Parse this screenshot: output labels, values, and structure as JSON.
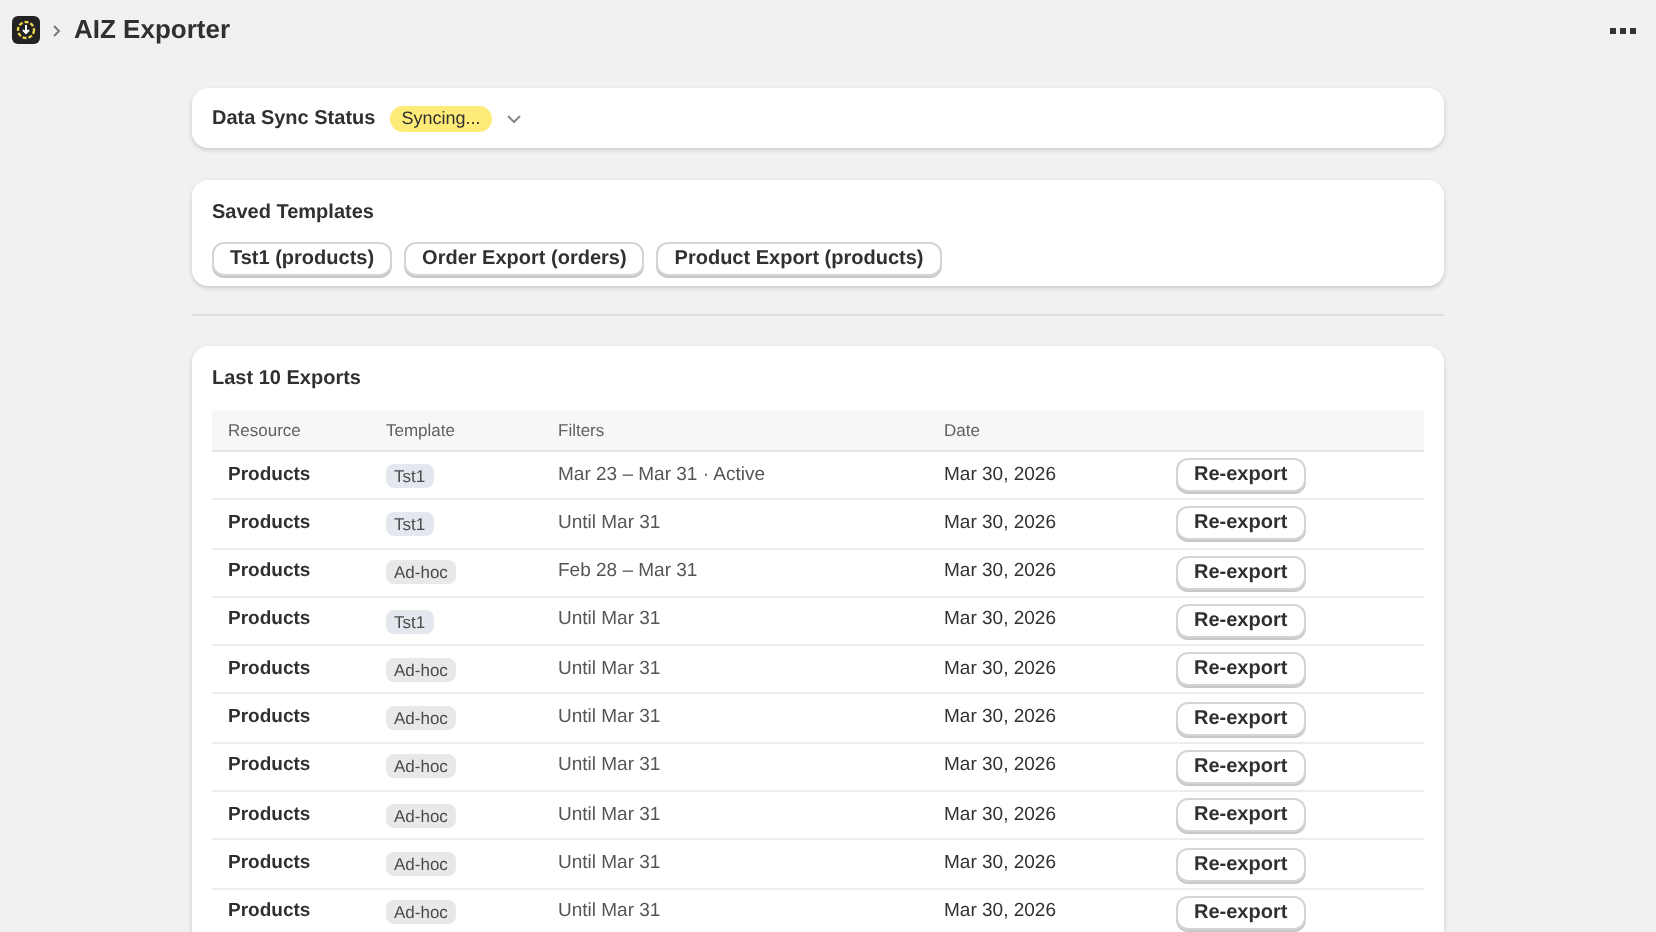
{
  "header": {
    "title": "AIZ Exporter"
  },
  "sync": {
    "title": "Data Sync Status",
    "status": "Syncing..."
  },
  "templates": {
    "title": "Saved Templates",
    "items": [
      "Tst1 (products)",
      "Order Export (orders)",
      "Product Export (products)"
    ]
  },
  "exports": {
    "title": "Last 10 Exports",
    "columns": [
      "Resource",
      "Template",
      "Filters",
      "Date"
    ],
    "rows": [
      {
        "resource": "Products",
        "template": "Tst1",
        "kind": "saved",
        "filters": "Mar 23 – Mar 31 · Active",
        "date": "Mar 30, 2026",
        "action": "Re-export"
      },
      {
        "resource": "Products",
        "template": "Tst1",
        "kind": "saved",
        "filters": "Until Mar 31",
        "date": "Mar 30, 2026",
        "action": "Re-export"
      },
      {
        "resource": "Products",
        "template": "Ad-hoc",
        "kind": "adhoc",
        "filters": "Feb 28 – Mar 31",
        "date": "Mar 30, 2026",
        "action": "Re-export"
      },
      {
        "resource": "Products",
        "template": "Tst1",
        "kind": "saved",
        "filters": "Until Mar 31",
        "date": "Mar 30, 2026",
        "action": "Re-export"
      },
      {
        "resource": "Products",
        "template": "Ad-hoc",
        "kind": "adhoc",
        "filters": "Until Mar 31",
        "date": "Mar 30, 2026",
        "action": "Re-export"
      },
      {
        "resource": "Products",
        "template": "Ad-hoc",
        "kind": "adhoc",
        "filters": "Until Mar 31",
        "date": "Mar 30, 2026",
        "action": "Re-export"
      },
      {
        "resource": "Products",
        "template": "Ad-hoc",
        "kind": "adhoc",
        "filters": "Until Mar 31",
        "date": "Mar 30, 2026",
        "action": "Re-export"
      },
      {
        "resource": "Products",
        "template": "Ad-hoc",
        "kind": "adhoc",
        "filters": "Until Mar 31",
        "date": "Mar 30, 2026",
        "action": "Re-export"
      },
      {
        "resource": "Products",
        "template": "Ad-hoc",
        "kind": "adhoc",
        "filters": "Until Mar 31",
        "date": "Mar 30, 2026",
        "action": "Re-export"
      },
      {
        "resource": "Products",
        "template": "Ad-hoc",
        "kind": "adhoc",
        "filters": "Until Mar 31",
        "date": "Mar 30, 2026",
        "action": "Re-export"
      }
    ]
  }
}
